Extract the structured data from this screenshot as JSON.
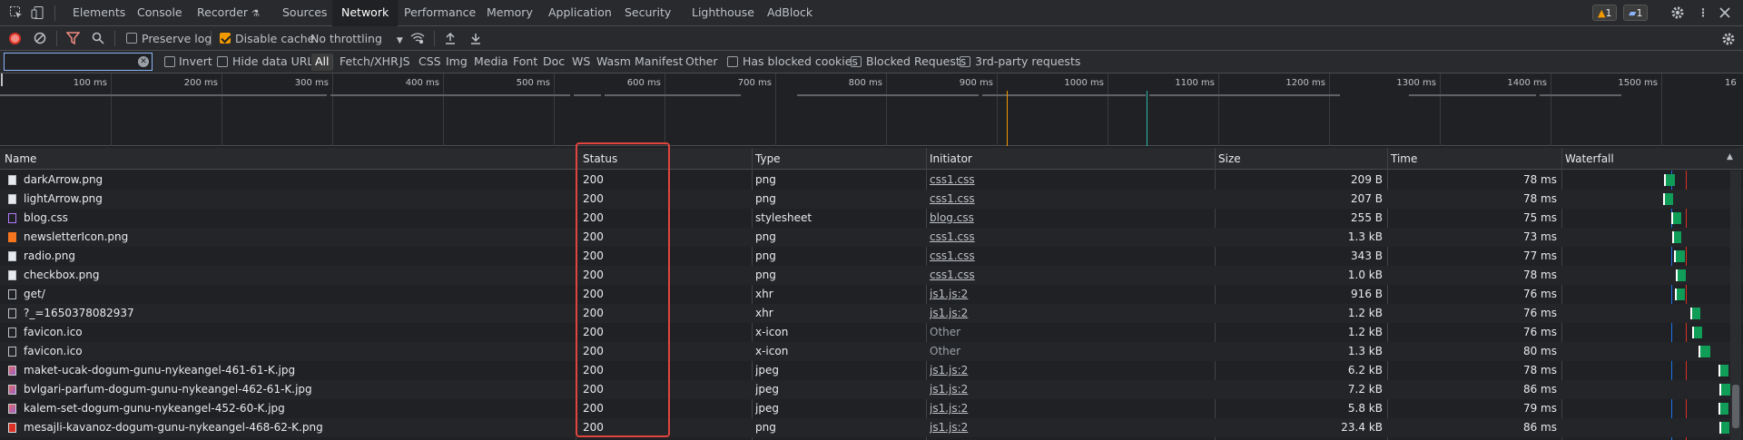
{
  "tabs": [
    "Elements",
    "Console",
    "Recorder",
    "Sources",
    "Network",
    "Performance",
    "Memory",
    "Application",
    "Security",
    "Lighthouse",
    "AdBlock"
  ],
  "active_tab": "Network",
  "badges": {
    "warnings": "1",
    "messages": "1"
  },
  "toolbar": {
    "preserve_log": "Preserve log",
    "disable_cache": "Disable cache",
    "throttling": "No throttling"
  },
  "filter": {
    "value": "",
    "invert": "Invert",
    "hide_data_urls": "Hide data URLs",
    "types": [
      "All",
      "Fetch/XHR",
      "JS",
      "CSS",
      "Img",
      "Media",
      "Font",
      "Doc",
      "WS",
      "Wasm",
      "Manifest",
      "Other"
    ],
    "has_blocked_cookies": "Has blocked cookies",
    "blocked_requests": "Blocked Requests",
    "third_party": "3rd-party requests"
  },
  "overview_ticks": [
    "100 ms",
    "200 ms",
    "300 ms",
    "400 ms",
    "500 ms",
    "600 ms",
    "700 ms",
    "800 ms",
    "900 ms",
    "1000 ms",
    "1100 ms",
    "1200 ms",
    "1300 ms",
    "1400 ms",
    "1500 ms",
    "16"
  ],
  "columns": {
    "name": "Name",
    "status": "Status",
    "type": "Type",
    "initiator": "Initiator",
    "size": "Size",
    "time": "Time",
    "waterfall": "Waterfall"
  },
  "rows": [
    {
      "name": "darkArrow.png",
      "status": "200",
      "type": "png",
      "initiator": "css1.css",
      "size": "209 B",
      "time": "78 ms",
      "icon": "image-icon"
    },
    {
      "name": "lightArrow.png",
      "status": "200",
      "type": "png",
      "initiator": "css1.css",
      "size": "207 B",
      "time": "78 ms",
      "icon": "image-icon"
    },
    {
      "name": "blog.css",
      "status": "200",
      "type": "stylesheet",
      "initiator": "blog.css",
      "size": "255 B",
      "time": "75 ms",
      "icon": "stylesheet-icon"
    },
    {
      "name": "newsletterIcon.png",
      "status": "200",
      "type": "png",
      "initiator": "css1.css",
      "size": "1.3 kB",
      "time": "73 ms",
      "icon": "image-icon"
    },
    {
      "name": "radio.png",
      "status": "200",
      "type": "png",
      "initiator": "css1.css",
      "size": "343 B",
      "time": "77 ms",
      "icon": "image-icon"
    },
    {
      "name": "checkbox.png",
      "status": "200",
      "type": "png",
      "initiator": "css1.css",
      "size": "1.0 kB",
      "time": "78 ms",
      "icon": "image-icon"
    },
    {
      "name": "get/",
      "status": "200",
      "type": "xhr",
      "initiator": "js1.js:2",
      "size": "916 B",
      "time": "76 ms",
      "icon": "document-icon"
    },
    {
      "name": "?_=1650378082937",
      "status": "200",
      "type": "xhr",
      "initiator": "js1.js:2",
      "size": "1.2 kB",
      "time": "76 ms",
      "icon": "document-icon"
    },
    {
      "name": "favicon.ico",
      "status": "200",
      "type": "x-icon",
      "initiator": "Other",
      "size": "1.2 kB",
      "time": "76 ms",
      "icon": "document-icon"
    },
    {
      "name": "favicon.ico",
      "status": "200",
      "type": "x-icon",
      "initiator": "Other",
      "size": "1.3 kB",
      "time": "80 ms",
      "icon": "document-icon"
    },
    {
      "name": "maket-ucak-dogum-gunu-nykeangel-461-61-K.jpg",
      "status": "200",
      "type": "jpeg",
      "initiator": "js1.js:2",
      "size": "6.2 kB",
      "time": "78 ms",
      "icon": "image-icon"
    },
    {
      "name": "bvlgari-parfum-dogum-gunu-nykeangel-462-61-K.jpg",
      "status": "200",
      "type": "jpeg",
      "initiator": "js1.js:2",
      "size": "7.2 kB",
      "time": "86 ms",
      "icon": "image-icon"
    },
    {
      "name": "kalem-set-dogum-gunu-nykeangel-452-60-K.jpg",
      "status": "200",
      "type": "jpeg",
      "initiator": "js1.js:2",
      "size": "5.8 kB",
      "time": "79 ms",
      "icon": "image-icon"
    },
    {
      "name": "mesajli-kavanoz-dogum-gunu-nykeangel-468-62-K.png",
      "status": "200",
      "type": "png",
      "initiator": "js1.js:2",
      "size": "23.4 kB",
      "time": "86 ms",
      "icon": "image-icon"
    }
  ]
}
